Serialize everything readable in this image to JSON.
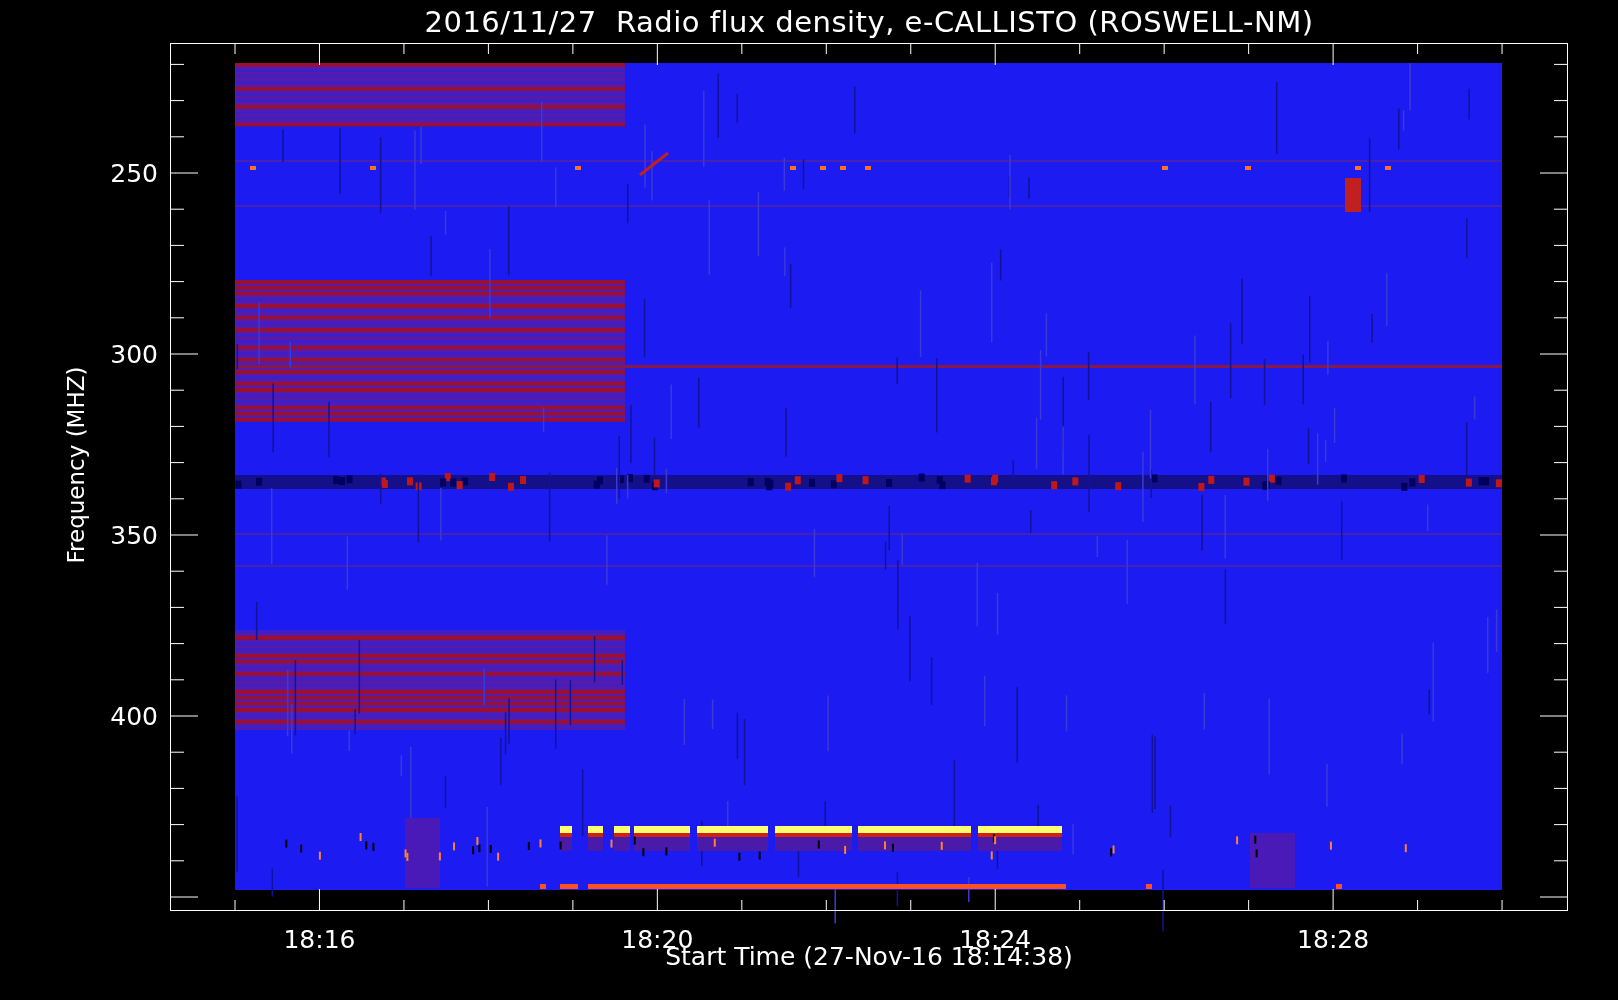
{
  "plot": {
    "title": "2016/11/27  Radio flux density, e-CALLISTO (ROSWELL-NM)",
    "xlabel": "Start Time (27-Nov-16 18:14:38)",
    "ylabel": "Frequency (MHZ)",
    "x_tick_labels": [
      "18:16",
      "18:20",
      "18:24",
      "18:28"
    ],
    "y_tick_labels": [
      "250",
      "300",
      "350",
      "400"
    ]
  }
}
